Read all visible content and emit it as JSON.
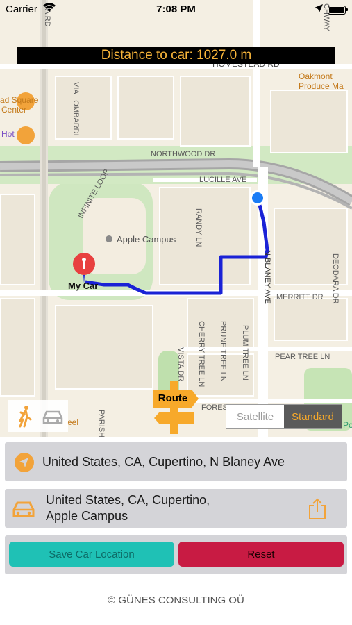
{
  "status_bar": {
    "carrier": "Carrier",
    "time": "7:08 PM"
  },
  "distance_banner": "Distance to car: 1027.0 m",
  "map": {
    "streets": [
      "HOMESTEAD RD",
      "NORTHWOOD DR",
      "LUCILLE AVE",
      "VIA LOMBARDI",
      "INFINITE LOOP",
      "RANDY LN",
      "N BLANEY AVE",
      "MERRITT DR",
      "PEAR TREE LN",
      "CHERRY TREE LN",
      "PRUNE TREE LN",
      "PLUM TREE LN",
      "VISTA DR",
      "FOREST",
      "PARISH",
      "DEODARA DR",
      "DA RD",
      "CHWAY"
    ],
    "places": [
      "Apple Campus",
      "Oakmont",
      "Produce Ma",
      "ad Square",
      "Center",
      "Hot",
      "eel",
      "Po"
    ],
    "my_car_label": "My Car",
    "route_label": "Route",
    "map_type": {
      "options": [
        "Satellite",
        "Standard"
      ],
      "selected": "Standard"
    },
    "colors": {
      "route": "#1a22d6",
      "user_dot": "#1a7cf5",
      "pin": "#e8403f"
    }
  },
  "current_location": {
    "icon": "location-arrow-icon",
    "text": "United States, CA, Cupertino, N Blaney Ave"
  },
  "car_location": {
    "icon": "car-icon",
    "line1": "United States, CA, Cupertino,",
    "line2": "Apple Campus",
    "share_icon": "share-icon"
  },
  "actions": {
    "save_label": "Save Car Location",
    "reset_label": "Reset"
  },
  "footer": "© GÜNES CONSULTING OÜ"
}
